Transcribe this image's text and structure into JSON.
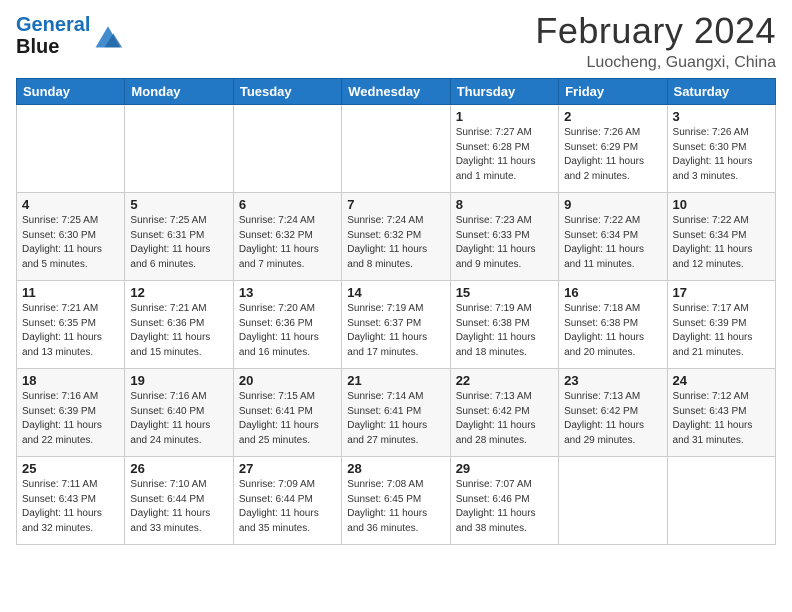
{
  "logo": {
    "line1": "General",
    "line2": "Blue"
  },
  "title": "February 2024",
  "subtitle": "Luocheng, Guangxi, China",
  "weekdays": [
    "Sunday",
    "Monday",
    "Tuesday",
    "Wednesday",
    "Thursday",
    "Friday",
    "Saturday"
  ],
  "weeks": [
    [
      {
        "day": "",
        "info": ""
      },
      {
        "day": "",
        "info": ""
      },
      {
        "day": "",
        "info": ""
      },
      {
        "day": "",
        "info": ""
      },
      {
        "day": "1",
        "info": "Sunrise: 7:27 AM\nSunset: 6:28 PM\nDaylight: 11 hours and 1 minute."
      },
      {
        "day": "2",
        "info": "Sunrise: 7:26 AM\nSunset: 6:29 PM\nDaylight: 11 hours and 2 minutes."
      },
      {
        "day": "3",
        "info": "Sunrise: 7:26 AM\nSunset: 6:30 PM\nDaylight: 11 hours and 3 minutes."
      }
    ],
    [
      {
        "day": "4",
        "info": "Sunrise: 7:25 AM\nSunset: 6:30 PM\nDaylight: 11 hours and 5 minutes."
      },
      {
        "day": "5",
        "info": "Sunrise: 7:25 AM\nSunset: 6:31 PM\nDaylight: 11 hours and 6 minutes."
      },
      {
        "day": "6",
        "info": "Sunrise: 7:24 AM\nSunset: 6:32 PM\nDaylight: 11 hours and 7 minutes."
      },
      {
        "day": "7",
        "info": "Sunrise: 7:24 AM\nSunset: 6:32 PM\nDaylight: 11 hours and 8 minutes."
      },
      {
        "day": "8",
        "info": "Sunrise: 7:23 AM\nSunset: 6:33 PM\nDaylight: 11 hours and 9 minutes."
      },
      {
        "day": "9",
        "info": "Sunrise: 7:22 AM\nSunset: 6:34 PM\nDaylight: 11 hours and 11 minutes."
      },
      {
        "day": "10",
        "info": "Sunrise: 7:22 AM\nSunset: 6:34 PM\nDaylight: 11 hours and 12 minutes."
      }
    ],
    [
      {
        "day": "11",
        "info": "Sunrise: 7:21 AM\nSunset: 6:35 PM\nDaylight: 11 hours and 13 minutes."
      },
      {
        "day": "12",
        "info": "Sunrise: 7:21 AM\nSunset: 6:36 PM\nDaylight: 11 hours and 15 minutes."
      },
      {
        "day": "13",
        "info": "Sunrise: 7:20 AM\nSunset: 6:36 PM\nDaylight: 11 hours and 16 minutes."
      },
      {
        "day": "14",
        "info": "Sunrise: 7:19 AM\nSunset: 6:37 PM\nDaylight: 11 hours and 17 minutes."
      },
      {
        "day": "15",
        "info": "Sunrise: 7:19 AM\nSunset: 6:38 PM\nDaylight: 11 hours and 18 minutes."
      },
      {
        "day": "16",
        "info": "Sunrise: 7:18 AM\nSunset: 6:38 PM\nDaylight: 11 hours and 20 minutes."
      },
      {
        "day": "17",
        "info": "Sunrise: 7:17 AM\nSunset: 6:39 PM\nDaylight: 11 hours and 21 minutes."
      }
    ],
    [
      {
        "day": "18",
        "info": "Sunrise: 7:16 AM\nSunset: 6:39 PM\nDaylight: 11 hours and 22 minutes."
      },
      {
        "day": "19",
        "info": "Sunrise: 7:16 AM\nSunset: 6:40 PM\nDaylight: 11 hours and 24 minutes."
      },
      {
        "day": "20",
        "info": "Sunrise: 7:15 AM\nSunset: 6:41 PM\nDaylight: 11 hours and 25 minutes."
      },
      {
        "day": "21",
        "info": "Sunrise: 7:14 AM\nSunset: 6:41 PM\nDaylight: 11 hours and 27 minutes."
      },
      {
        "day": "22",
        "info": "Sunrise: 7:13 AM\nSunset: 6:42 PM\nDaylight: 11 hours and 28 minutes."
      },
      {
        "day": "23",
        "info": "Sunrise: 7:13 AM\nSunset: 6:42 PM\nDaylight: 11 hours and 29 minutes."
      },
      {
        "day": "24",
        "info": "Sunrise: 7:12 AM\nSunset: 6:43 PM\nDaylight: 11 hours and 31 minutes."
      }
    ],
    [
      {
        "day": "25",
        "info": "Sunrise: 7:11 AM\nSunset: 6:43 PM\nDaylight: 11 hours and 32 minutes."
      },
      {
        "day": "26",
        "info": "Sunrise: 7:10 AM\nSunset: 6:44 PM\nDaylight: 11 hours and 33 minutes."
      },
      {
        "day": "27",
        "info": "Sunrise: 7:09 AM\nSunset: 6:44 PM\nDaylight: 11 hours and 35 minutes."
      },
      {
        "day": "28",
        "info": "Sunrise: 7:08 AM\nSunset: 6:45 PM\nDaylight: 11 hours and 36 minutes."
      },
      {
        "day": "29",
        "info": "Sunrise: 7:07 AM\nSunset: 6:46 PM\nDaylight: 11 hours and 38 minutes."
      },
      {
        "day": "",
        "info": ""
      },
      {
        "day": "",
        "info": ""
      }
    ]
  ]
}
